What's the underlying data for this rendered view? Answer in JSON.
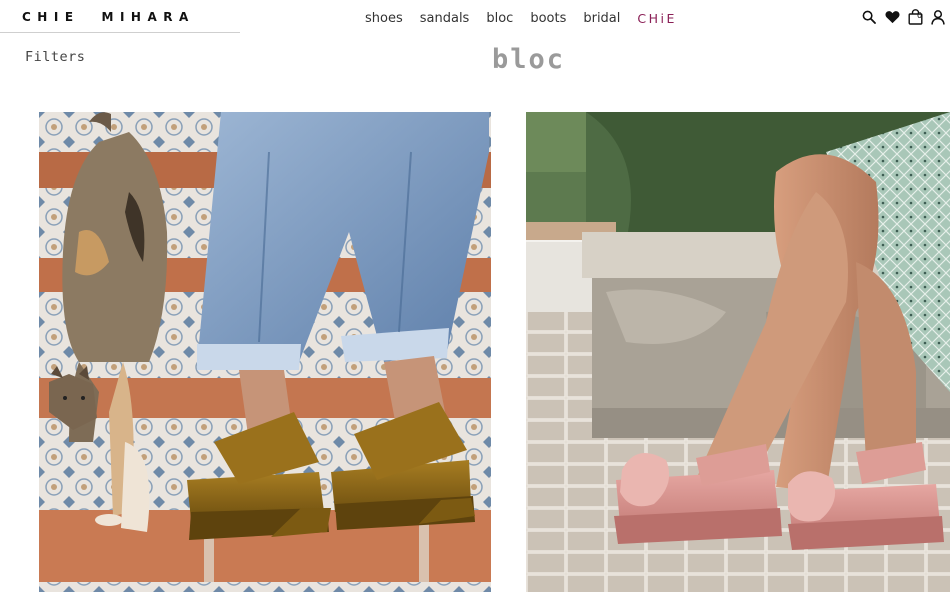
{
  "header": {
    "logo_part1": "CHIE",
    "logo_part2": "MIHARA",
    "nav": [
      {
        "label": "shoes"
      },
      {
        "label": "sandals"
      },
      {
        "label": "bloc"
      },
      {
        "label": "boots"
      },
      {
        "label": "bridal"
      },
      {
        "label": "CHiE"
      }
    ],
    "cart_count": "0",
    "icons": [
      "search-icon",
      "heart-icon",
      "cart-icon",
      "user-icon"
    ]
  },
  "page": {
    "filters_label": "Filters",
    "title": "bloc"
  },
  "colors": {
    "chie_accent": "#8a1f56",
    "title_gray": "#9a9a9a"
  }
}
